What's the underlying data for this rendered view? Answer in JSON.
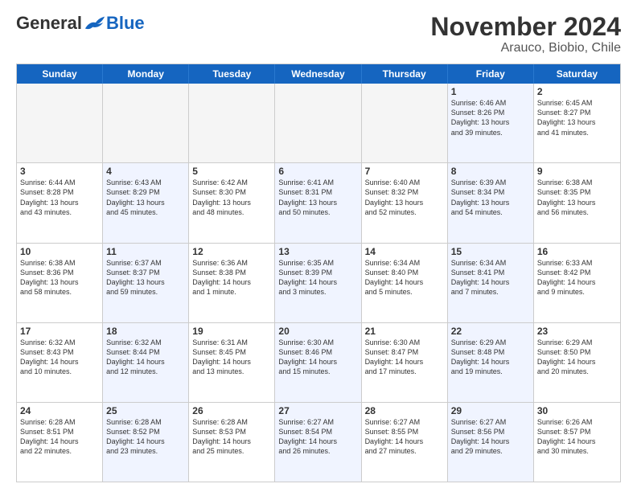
{
  "header": {
    "logo": {
      "general": "General",
      "blue": "Blue"
    },
    "title": "November 2024",
    "location": "Arauco, Biobio, Chile"
  },
  "weekdays": [
    "Sunday",
    "Monday",
    "Tuesday",
    "Wednesday",
    "Thursday",
    "Friday",
    "Saturday"
  ],
  "weeks": [
    [
      {
        "day": "",
        "info": "",
        "empty": true
      },
      {
        "day": "",
        "info": "",
        "empty": true
      },
      {
        "day": "",
        "info": "",
        "empty": true
      },
      {
        "day": "",
        "info": "",
        "empty": true
      },
      {
        "day": "",
        "info": "",
        "empty": true
      },
      {
        "day": "1",
        "info": "Sunrise: 6:46 AM\nSunset: 8:26 PM\nDaylight: 13 hours\nand 39 minutes.",
        "empty": false
      },
      {
        "day": "2",
        "info": "Sunrise: 6:45 AM\nSunset: 8:27 PM\nDaylight: 13 hours\nand 41 minutes.",
        "empty": false
      }
    ],
    [
      {
        "day": "3",
        "info": "Sunrise: 6:44 AM\nSunset: 8:28 PM\nDaylight: 13 hours\nand 43 minutes.",
        "empty": false
      },
      {
        "day": "4",
        "info": "Sunrise: 6:43 AM\nSunset: 8:29 PM\nDaylight: 13 hours\nand 45 minutes.",
        "empty": false
      },
      {
        "day": "5",
        "info": "Sunrise: 6:42 AM\nSunset: 8:30 PM\nDaylight: 13 hours\nand 48 minutes.",
        "empty": false
      },
      {
        "day": "6",
        "info": "Sunrise: 6:41 AM\nSunset: 8:31 PM\nDaylight: 13 hours\nand 50 minutes.",
        "empty": false
      },
      {
        "day": "7",
        "info": "Sunrise: 6:40 AM\nSunset: 8:32 PM\nDaylight: 13 hours\nand 52 minutes.",
        "empty": false
      },
      {
        "day": "8",
        "info": "Sunrise: 6:39 AM\nSunset: 8:34 PM\nDaylight: 13 hours\nand 54 minutes.",
        "empty": false
      },
      {
        "day": "9",
        "info": "Sunrise: 6:38 AM\nSunset: 8:35 PM\nDaylight: 13 hours\nand 56 minutes.",
        "empty": false
      }
    ],
    [
      {
        "day": "10",
        "info": "Sunrise: 6:38 AM\nSunset: 8:36 PM\nDaylight: 13 hours\nand 58 minutes.",
        "empty": false
      },
      {
        "day": "11",
        "info": "Sunrise: 6:37 AM\nSunset: 8:37 PM\nDaylight: 13 hours\nand 59 minutes.",
        "empty": false
      },
      {
        "day": "12",
        "info": "Sunrise: 6:36 AM\nSunset: 8:38 PM\nDaylight: 14 hours\nand 1 minute.",
        "empty": false
      },
      {
        "day": "13",
        "info": "Sunrise: 6:35 AM\nSunset: 8:39 PM\nDaylight: 14 hours\nand 3 minutes.",
        "empty": false
      },
      {
        "day": "14",
        "info": "Sunrise: 6:34 AM\nSunset: 8:40 PM\nDaylight: 14 hours\nand 5 minutes.",
        "empty": false
      },
      {
        "day": "15",
        "info": "Sunrise: 6:34 AM\nSunset: 8:41 PM\nDaylight: 14 hours\nand 7 minutes.",
        "empty": false
      },
      {
        "day": "16",
        "info": "Sunrise: 6:33 AM\nSunset: 8:42 PM\nDaylight: 14 hours\nand 9 minutes.",
        "empty": false
      }
    ],
    [
      {
        "day": "17",
        "info": "Sunrise: 6:32 AM\nSunset: 8:43 PM\nDaylight: 14 hours\nand 10 minutes.",
        "empty": false
      },
      {
        "day": "18",
        "info": "Sunrise: 6:32 AM\nSunset: 8:44 PM\nDaylight: 14 hours\nand 12 minutes.",
        "empty": false
      },
      {
        "day": "19",
        "info": "Sunrise: 6:31 AM\nSunset: 8:45 PM\nDaylight: 14 hours\nand 13 minutes.",
        "empty": false
      },
      {
        "day": "20",
        "info": "Sunrise: 6:30 AM\nSunset: 8:46 PM\nDaylight: 14 hours\nand 15 minutes.",
        "empty": false
      },
      {
        "day": "21",
        "info": "Sunrise: 6:30 AM\nSunset: 8:47 PM\nDaylight: 14 hours\nand 17 minutes.",
        "empty": false
      },
      {
        "day": "22",
        "info": "Sunrise: 6:29 AM\nSunset: 8:48 PM\nDaylight: 14 hours\nand 19 minutes.",
        "empty": false
      },
      {
        "day": "23",
        "info": "Sunrise: 6:29 AM\nSunset: 8:50 PM\nDaylight: 14 hours\nand 20 minutes.",
        "empty": false
      }
    ],
    [
      {
        "day": "24",
        "info": "Sunrise: 6:28 AM\nSunset: 8:51 PM\nDaylight: 14 hours\nand 22 minutes.",
        "empty": false
      },
      {
        "day": "25",
        "info": "Sunrise: 6:28 AM\nSunset: 8:52 PM\nDaylight: 14 hours\nand 23 minutes.",
        "empty": false
      },
      {
        "day": "26",
        "info": "Sunrise: 6:28 AM\nSunset: 8:53 PM\nDaylight: 14 hours\nand 25 minutes.",
        "empty": false
      },
      {
        "day": "27",
        "info": "Sunrise: 6:27 AM\nSunset: 8:54 PM\nDaylight: 14 hours\nand 26 minutes.",
        "empty": false
      },
      {
        "day": "28",
        "info": "Sunrise: 6:27 AM\nSunset: 8:55 PM\nDaylight: 14 hours\nand 27 minutes.",
        "empty": false
      },
      {
        "day": "29",
        "info": "Sunrise: 6:27 AM\nSunset: 8:56 PM\nDaylight: 14 hours\nand 29 minutes.",
        "empty": false
      },
      {
        "day": "30",
        "info": "Sunrise: 6:26 AM\nSunset: 8:57 PM\nDaylight: 14 hours\nand 30 minutes.",
        "empty": false
      }
    ]
  ]
}
